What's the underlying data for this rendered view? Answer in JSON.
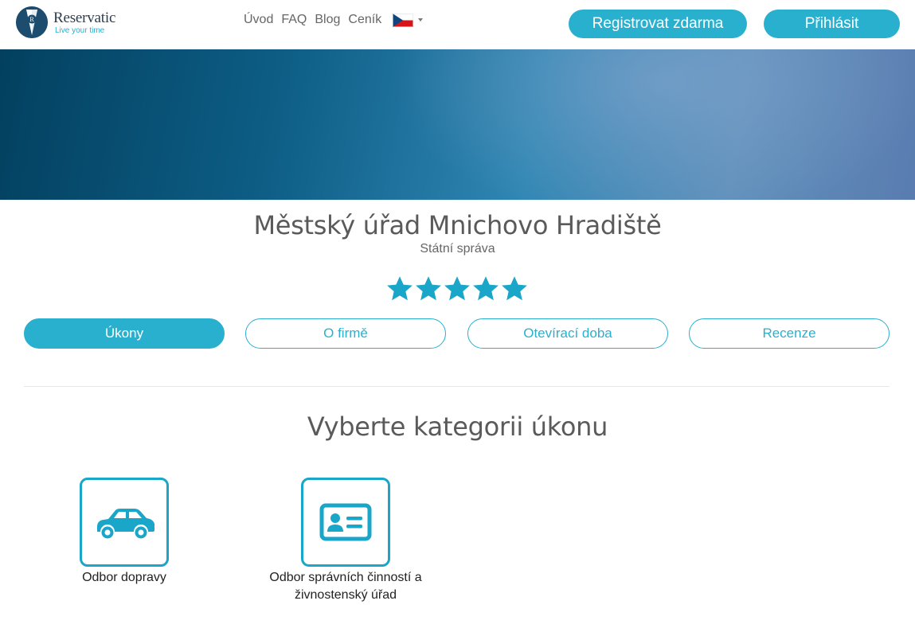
{
  "header": {
    "logo_name": "Reservatic",
    "logo_tagline": "Live your time",
    "nav": [
      "Úvod",
      "FAQ",
      "Blog",
      "Ceník"
    ],
    "language_icon": "czech-flag-icon",
    "register_label": "Registrovat zdarma",
    "login_label": "Přihlásit"
  },
  "company": {
    "name": "Městský úřad Mnichovo Hradiště",
    "category": "Státní správa",
    "rating": 5,
    "rating_max": 5
  },
  "tabs": [
    {
      "label": "Úkony",
      "active": true
    },
    {
      "label": "O firmě",
      "active": false
    },
    {
      "label": "Otevírací doba",
      "active": false
    },
    {
      "label": "Recenze",
      "active": false
    }
  ],
  "section": {
    "title": "Vyberte kategorii úkonu"
  },
  "categories": [
    {
      "label": "Odbor dopravy",
      "icon": "car-icon"
    },
    {
      "label": "Odbor správních činností a živnostenský úřad",
      "icon": "id-card-icon"
    }
  ],
  "colors": {
    "accent": "#2ab0cf",
    "accent_dark": "#1aa6c9",
    "hero_dark": "#03405f"
  }
}
